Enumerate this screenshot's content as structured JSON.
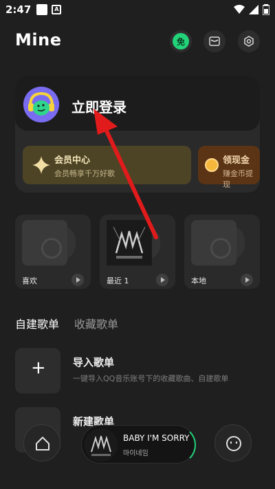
{
  "status_bar": {
    "time": "2:47"
  },
  "header": {
    "title": "Mine",
    "free_badge": "免"
  },
  "login_card": {
    "login_text": "立即登录",
    "vip": {
      "title": "会员中心",
      "subtitle": "会员畅享千万好歌"
    },
    "coin": {
      "title": "领现金",
      "subtitle": "赚金币提现"
    }
  },
  "tiles": [
    {
      "label": "喜欢"
    },
    {
      "label": "最近 1"
    },
    {
      "label": "本地"
    }
  ],
  "playlist_tabs": {
    "created": "自建歌单",
    "favorited": "收藏歌单"
  },
  "rows": [
    {
      "title": "导入歌单",
      "subtitle": "一键导入QQ音乐账号下的收藏歌曲、自建歌单",
      "icon": "+"
    },
    {
      "title": "新建歌单",
      "subtitle": "",
      "icon": ""
    }
  ],
  "player": {
    "song": "BABY I'M SORRY",
    "artist": "마이네임",
    "accent": "#22d37a"
  },
  "colors": {
    "background": "#1f1f1f",
    "accent": "#22d37a",
    "arrow": "#e11b1b"
  },
  "icons": [
    "wifi-icon",
    "signal-icon",
    "battery-icon",
    "mail-icon",
    "settings-icon",
    "home-icon",
    "face-icon",
    "star-icon",
    "coin-icon"
  ]
}
